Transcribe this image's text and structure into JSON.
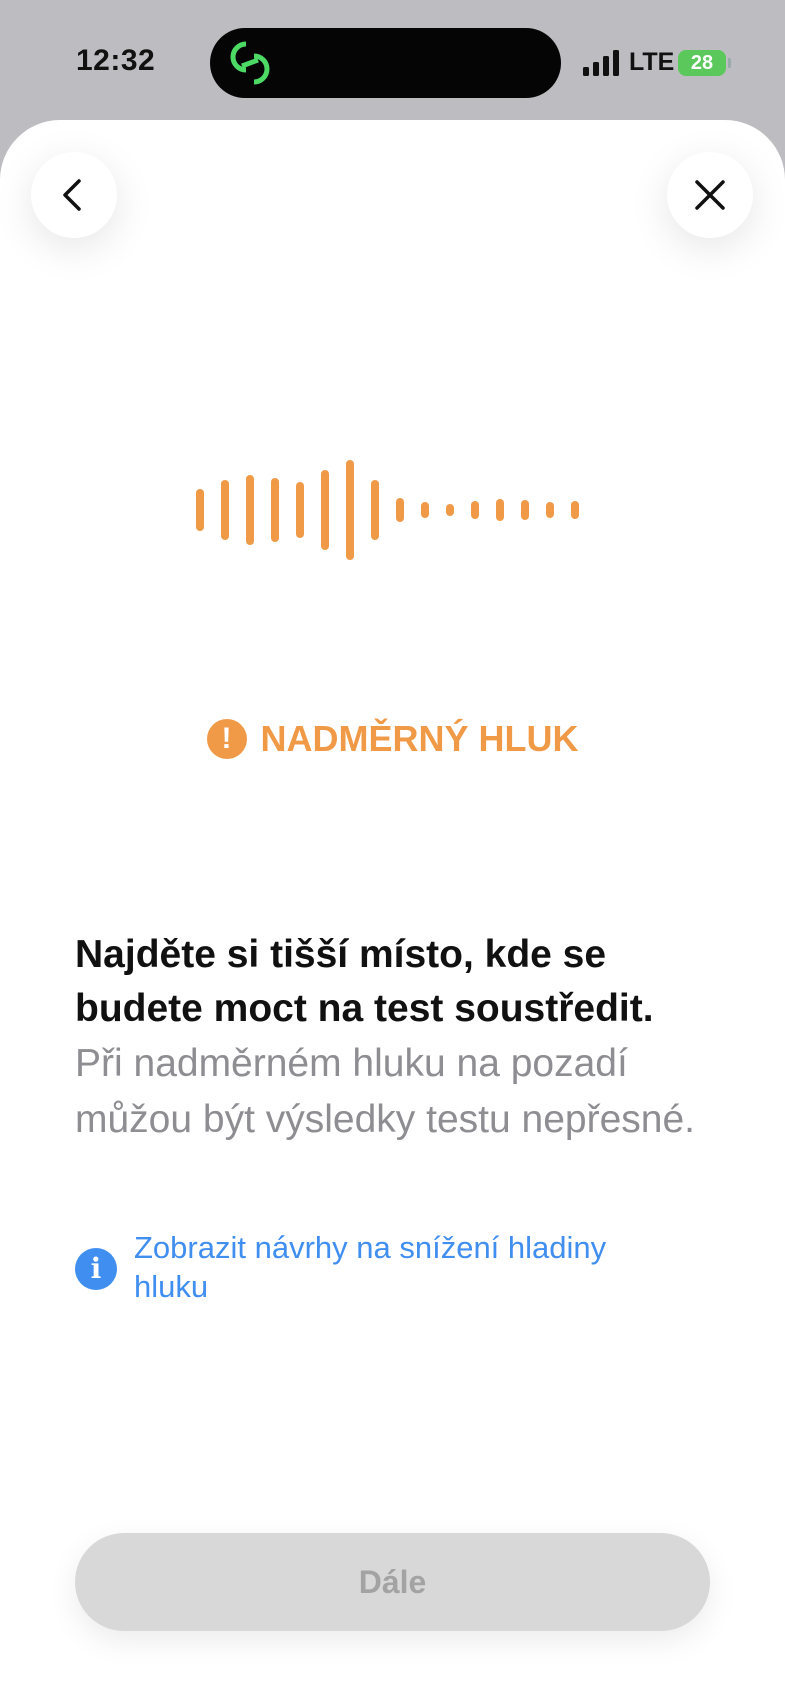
{
  "status_bar": {
    "time": "12:32",
    "network": "LTE",
    "battery": "28",
    "signal_icon": "cellular-signal-icon",
    "island_icon": "linked-rings-icon"
  },
  "nav": {
    "back_icon": "chevron-left-icon",
    "close_icon": "close-icon"
  },
  "visual": {
    "icon": "sound-wave-icon",
    "accent_color": "#f09a48"
  },
  "warning": {
    "icon": "exclamation-circle-icon",
    "label": "NADMĚRNÝ HLUK"
  },
  "content": {
    "headline": "Najděte si tišší místo, kde se budete moct na test soustředit.",
    "body": "Při nadměrném hluku na pozadí můžou být výsledky testu nepřesné."
  },
  "info_link": {
    "icon": "info-circle-icon",
    "label": "Zobrazit návrhy na snížení hladiny hluku",
    "color": "#3f8ef0"
  },
  "footer": {
    "continue_label": "Dále"
  }
}
